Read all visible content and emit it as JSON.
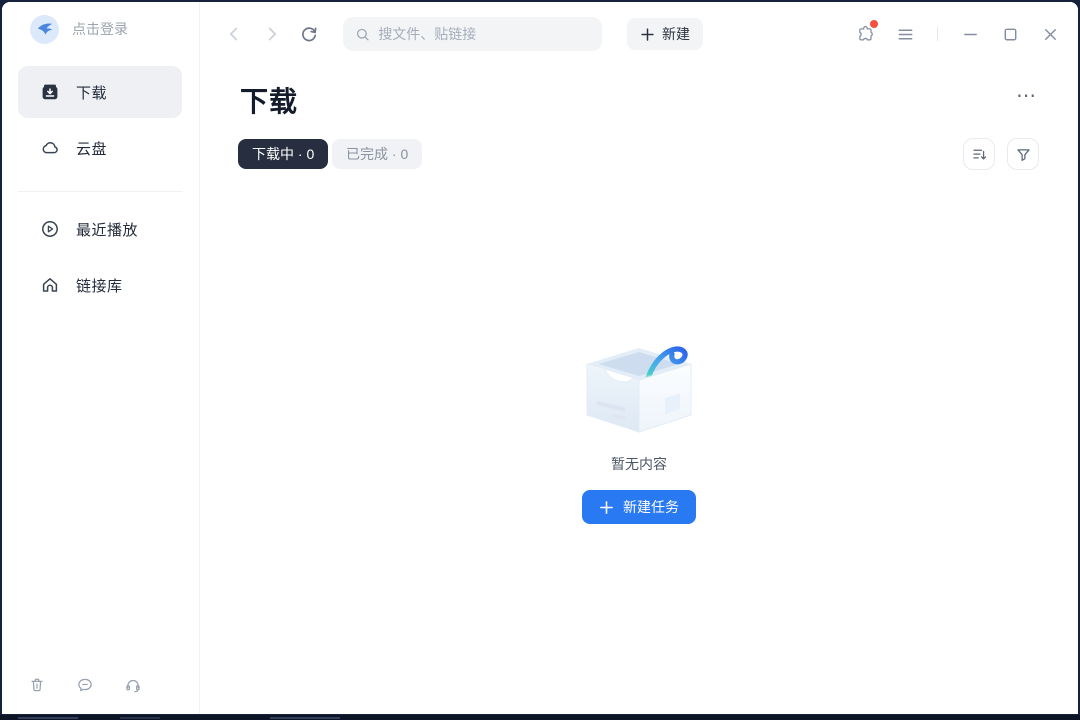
{
  "sidebar": {
    "login_label": "点击登录",
    "items": [
      {
        "label": "下载"
      },
      {
        "label": "云盘"
      },
      {
        "label": "最近播放"
      },
      {
        "label": "链接库"
      }
    ]
  },
  "toolbar": {
    "search_placeholder": "搜文件、贴链接",
    "new_button_label": "新建"
  },
  "header": {
    "title": "下载",
    "more_label": "⋯"
  },
  "tabs": [
    {
      "label": "下载中 · 0",
      "active": true
    },
    {
      "label": "已完成 · 0",
      "active": false
    }
  ],
  "empty_state": {
    "message": "暂无内容",
    "action_label": "新建任务"
  },
  "colors": {
    "accent_blue": "#2979F2",
    "active_tab_bg": "#272E3F",
    "logo_blue": "#4A86DC",
    "notification_red": "#F4503E",
    "frame_dark": "#16213C"
  }
}
